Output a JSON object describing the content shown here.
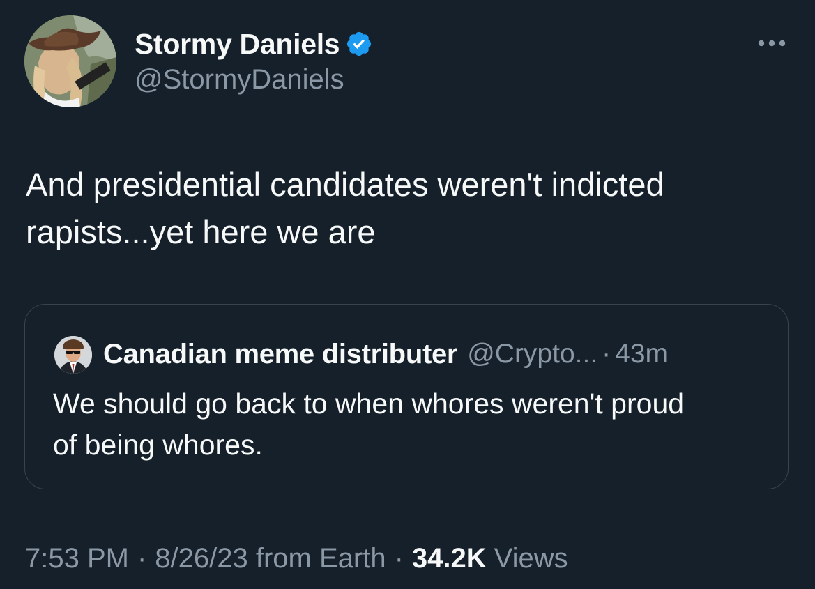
{
  "tweet": {
    "author": {
      "display_name": "Stormy Daniels",
      "handle": "@StormyDaniels",
      "verified": true,
      "avatar_icon": "profile-photo-cowboy-hat"
    },
    "more_icon": "more-horizontal-icon",
    "text_lines": [
      "And presidential candidates weren't indicted",
      "rapists...yet here we are"
    ],
    "quoted": {
      "display_name": "Canadian meme distributer",
      "handle": "@Crypto...",
      "separator": "·",
      "time": "43m",
      "avatar_icon": "profile-photo-sunglasses",
      "text_lines": [
        "We should go back to when whores weren't proud",
        "of being whores."
      ]
    },
    "meta": {
      "time": "7:53 PM",
      "separator": "·",
      "date_source": "8/26/23 from Earth",
      "views_count": "34.2K",
      "views_label": "Views"
    }
  },
  "colors": {
    "background": "#15202b",
    "text_primary": "#f7f9f9",
    "text_secondary": "#8b98a5",
    "verified_blue": "#1d9bf0",
    "quote_border": "#38444d"
  }
}
